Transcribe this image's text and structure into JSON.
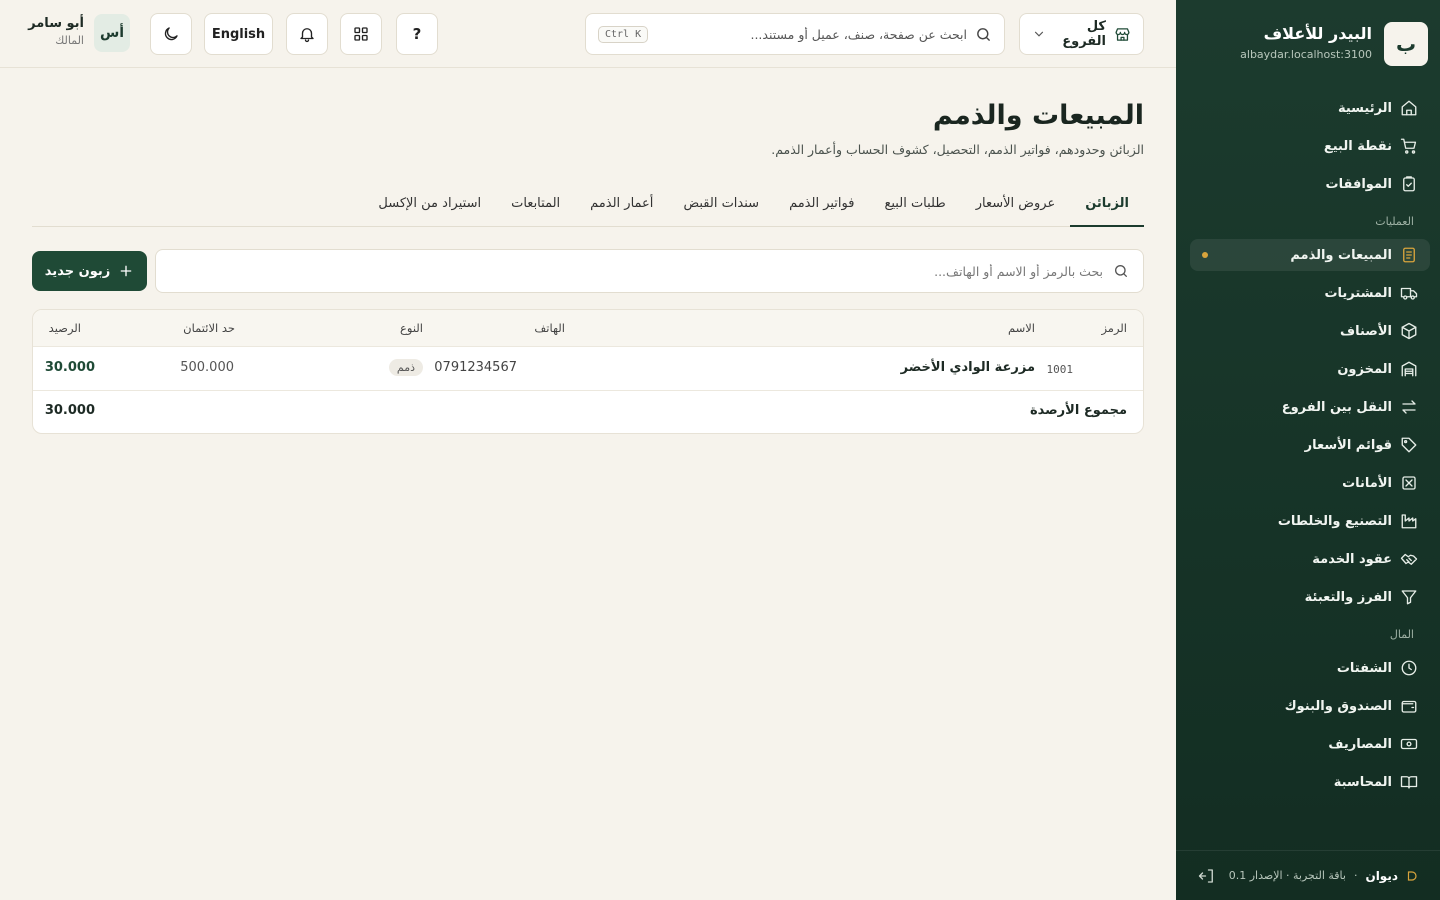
{
  "brand": {
    "logo": "ب",
    "name": "البيدر للأعلاف",
    "host": "albaydar.localhost:3100"
  },
  "nav": {
    "top": [
      {
        "label": "الرئيسية",
        "icon": "home-icon"
      },
      {
        "label": "نقطة البيع",
        "icon": "cart-icon"
      },
      {
        "label": "الموافقات",
        "icon": "clipboard-check-icon"
      }
    ],
    "operations_label": "العمليات",
    "operations": [
      {
        "label": "المبيعات والذمم",
        "icon": "receipt-icon",
        "active": true
      },
      {
        "label": "المشتريات",
        "icon": "truck-icon"
      },
      {
        "label": "الأصناف",
        "icon": "box-icon"
      },
      {
        "label": "المخزون",
        "icon": "warehouse-icon"
      },
      {
        "label": "النقل بين الفروع",
        "icon": "transfer-arrows-icon"
      },
      {
        "label": "قوائم الأسعار",
        "icon": "tag-icon"
      },
      {
        "label": "الأمانات",
        "icon": "x-box-icon"
      },
      {
        "label": "التصنيع والخلطات",
        "icon": "factory-icon"
      },
      {
        "label": "عقود الخدمة",
        "icon": "handshake-icon"
      },
      {
        "label": "الفرز والتعبئة",
        "icon": "filter-icon"
      }
    ],
    "money_label": "المال",
    "money": [
      {
        "label": "الشفتات",
        "icon": "clock-icon"
      },
      {
        "label": "الصندوق والبنوك",
        "icon": "wallet-icon"
      },
      {
        "label": "المصاريف",
        "icon": "banknote-icon"
      },
      {
        "label": "المحاسبة",
        "icon": "book-icon"
      }
    ]
  },
  "footer": {
    "product": "ديوان",
    "separator": "·",
    "plan": "باقة التجربة · الإصدار 0.1"
  },
  "topbar": {
    "branch": "كل الفروع",
    "search_placeholder": "ابحث عن صفحة، صنف، عميل أو مستند...",
    "shortcut": "Ctrl K",
    "help": "?",
    "language": "English",
    "user": {
      "initials": "أس",
      "name": "أبو سامر",
      "role": "المالك"
    }
  },
  "page": {
    "title": "المبيعات والذمم",
    "subtitle": "الزبائن وحدودهم، فواتير الذمم، التحصيل، كشوف الحساب وأعمار الذمم.",
    "tabs": [
      "الزبائن",
      "عروض الأسعار",
      "طلبات البيع",
      "فواتير الذمم",
      "سندات القبض",
      "أعمار الذمم",
      "المتابعات",
      "استيراد من الإكسل"
    ],
    "search_placeholder": "بحث بالرمز أو الاسم أو الهاتف...",
    "new_button": "زبون جديد"
  },
  "table": {
    "headers": {
      "code": "الرمز",
      "name": "الاسم",
      "phone": "الهاتف",
      "type": "النوع",
      "credit_limit": "حد الائتمان",
      "balance": "الرصيد"
    },
    "rows": [
      {
        "code": "1001",
        "name": "مزرعة الوادي الأخضر",
        "phone": "0791234567",
        "type": "ذمم",
        "credit_limit": "500.000",
        "balance": "30.000"
      }
    ],
    "total_label": "مجموع الأرصدة",
    "total_value": "30.000"
  },
  "colors": {
    "sidebar": "#1c3b2e",
    "accent": "#1f4a36",
    "active_dot": "#d8a43c",
    "background": "#f6f3ec"
  }
}
